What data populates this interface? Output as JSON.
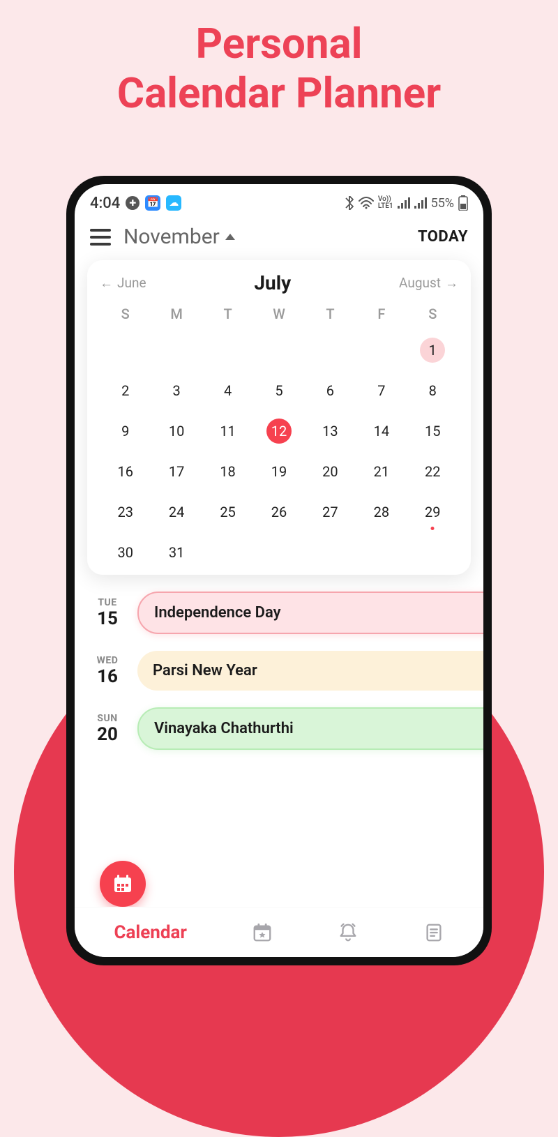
{
  "marketing": {
    "title_line1": "Personal",
    "title_line2": "Calendar Planner"
  },
  "status": {
    "time": "4:04",
    "battery": "55%",
    "lte": "Vo))\nLTE1"
  },
  "header": {
    "month": "November",
    "today": "TODAY"
  },
  "calendar": {
    "prev": "June",
    "current": "July",
    "next": "August",
    "days_of_week": [
      "S",
      "M",
      "T",
      "W",
      "T",
      "F",
      "S"
    ],
    "weeks": [
      [
        "",
        "",
        "",
        "",
        "",
        "",
        "1"
      ],
      [
        "2",
        "3",
        "4",
        "5",
        "6",
        "7",
        "8"
      ],
      [
        "9",
        "10",
        "11",
        "12",
        "13",
        "14",
        "15"
      ],
      [
        "16",
        "17",
        "18",
        "19",
        "20",
        "21",
        "22"
      ],
      [
        "23",
        "24",
        "25",
        "26",
        "27",
        "28",
        "29"
      ],
      [
        "30",
        "31",
        "",
        "",
        "",
        "",
        ""
      ]
    ],
    "highlighted_pink": "1",
    "selected": "12",
    "dotted": "29"
  },
  "events": [
    {
      "dow": "TUE",
      "day": "15",
      "title": "Independence Day",
      "style": "pink"
    },
    {
      "dow": "WED",
      "day": "16",
      "title": "Parsi New Year",
      "style": "cream"
    },
    {
      "dow": "SUN",
      "day": "20",
      "title": "Vinayaka Chathurthi",
      "style": "green"
    }
  ],
  "bottom_nav": {
    "active_label": "Calendar"
  }
}
